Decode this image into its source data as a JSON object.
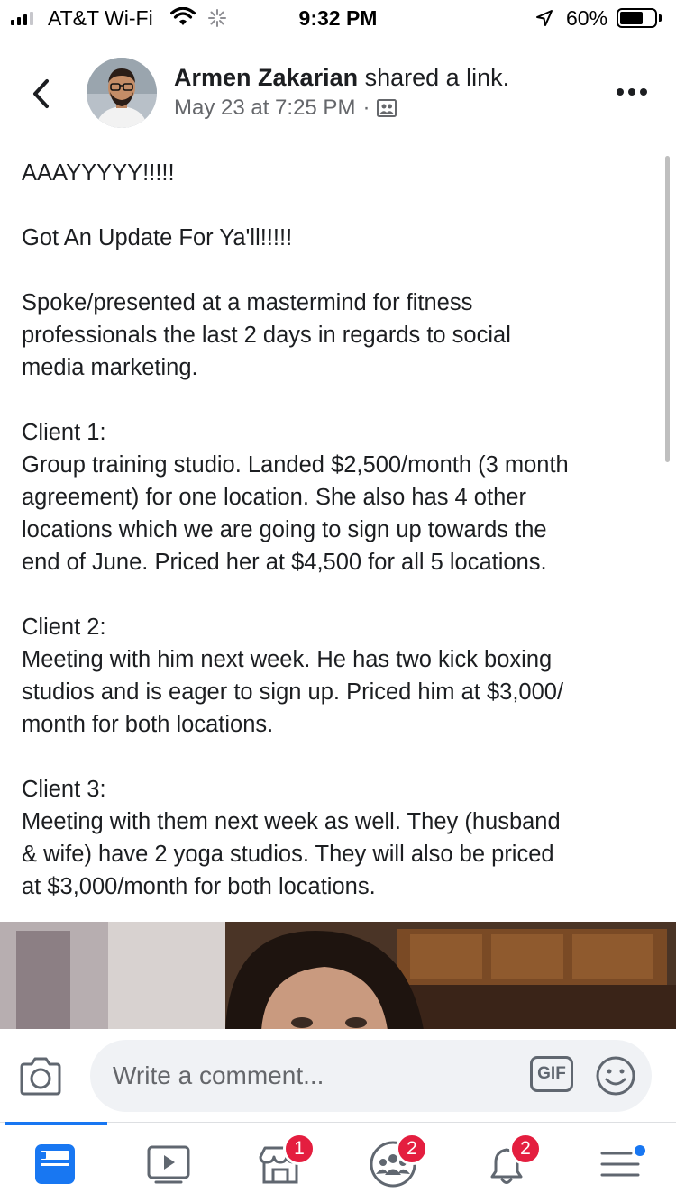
{
  "status_bar": {
    "carrier": "AT&T Wi-Fi",
    "time": "9:32 PM",
    "battery_percent": "60%",
    "battery_level": 0.6,
    "icons": [
      "signal-icon",
      "wifi-icon",
      "activity-icon",
      "location-icon",
      "battery-icon"
    ]
  },
  "post": {
    "author": "Armen Zakarian",
    "action": " shared a link.",
    "timestamp": "May 23 at 7:25 PM",
    "separator": "·",
    "paragraphs": [
      "AAAYYYYY!!!!!",
      "Got An Update For Ya'll!!!!!",
      "Spoke/presented at a mastermind for fitness\nprofessionals the last 2 days in regards to social\nmedia marketing.",
      "Client 1:\nGroup training studio. Landed $2,500/month (3 month\nagreement) for one location. She also has 4 other\nlocations which we are going to sign up towards the\nend of June. Priced her at $4,500 for all 5 locations.",
      "Client 2:\nMeeting with him next week. He has two kick boxing\nstudios and is eager to sign up. Priced him at $3,000/\nmonth for both locations.",
      "Client 3:\nMeeting with them next week as well. They (husband\n& wife) have 2 yoga studios. They will also be priced\nat $3,000/month for both locations."
    ]
  },
  "comment_bar": {
    "placeholder": "Write a comment...",
    "gif_label": "GIF"
  },
  "tab_bar": {
    "tabs": [
      {
        "name": "news-feed",
        "icon": "news-feed-icon",
        "badge": ""
      },
      {
        "name": "watch",
        "icon": "video-icon",
        "badge": ""
      },
      {
        "name": "marketplace",
        "icon": "marketplace-icon",
        "badge": "1"
      },
      {
        "name": "groups",
        "icon": "groups-icon",
        "badge": "2"
      },
      {
        "name": "notifications",
        "icon": "bell-icon",
        "badge": "2"
      },
      {
        "name": "menu",
        "icon": "menu-icon",
        "badge": ""
      }
    ]
  },
  "colors": {
    "accent": "#1877f2",
    "badge": "#e41e3f",
    "secondary_text": "#65676b",
    "input_bg": "#f0f2f5"
  }
}
